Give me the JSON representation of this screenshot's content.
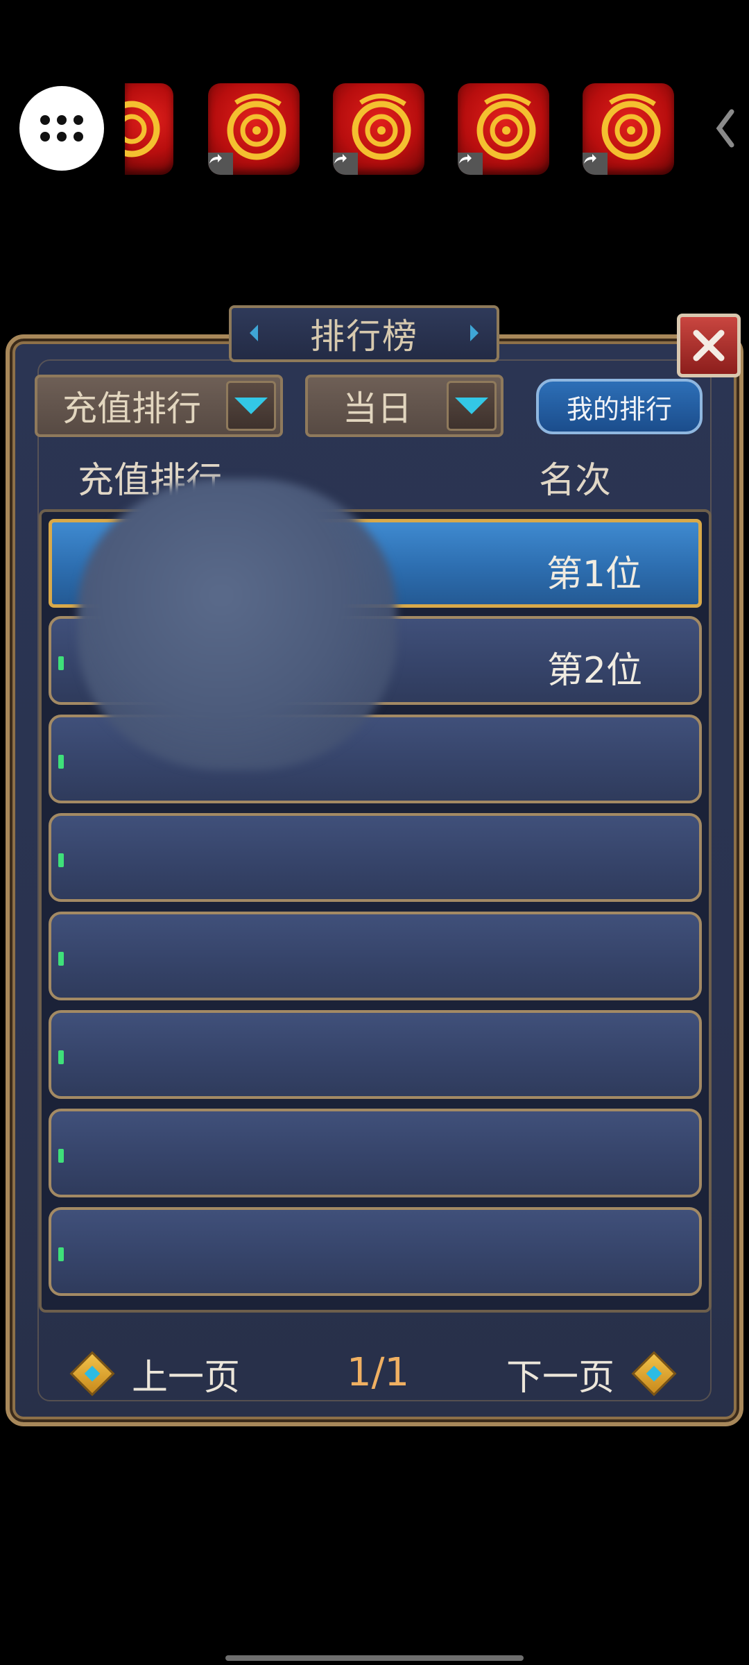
{
  "app_bar": {
    "menu_icon": "apps-grid-icon",
    "app_icons": [
      "dragon-app-icon",
      "dragon-app-icon",
      "dragon-app-icon",
      "dragon-app-icon",
      "dragon-app-icon"
    ],
    "collapse_icon": "chevron-left-icon"
  },
  "panel": {
    "title": "排行榜",
    "close_icon": "close-icon",
    "filters": {
      "type_selected": "充值排行",
      "period_selected": "当日",
      "my_rank_label": "我的排行"
    },
    "columns": {
      "left": "充值排行",
      "right": "名次"
    },
    "rows": [
      {
        "rank": "第1位"
      },
      {
        "rank": "第2位"
      },
      {
        "rank": ""
      },
      {
        "rank": ""
      },
      {
        "rank": ""
      },
      {
        "rank": ""
      },
      {
        "rank": ""
      },
      {
        "rank": ""
      }
    ],
    "pagination": {
      "prev_label": "上一页",
      "next_label": "下一页",
      "page": "1/1"
    }
  },
  "colors": {
    "panel_bg": "#2b3553",
    "frame_gold": "#a8885a",
    "highlight_row": "#2d6eb0",
    "accent_cyan": "#33c8e6",
    "close_red": "#b53430"
  }
}
